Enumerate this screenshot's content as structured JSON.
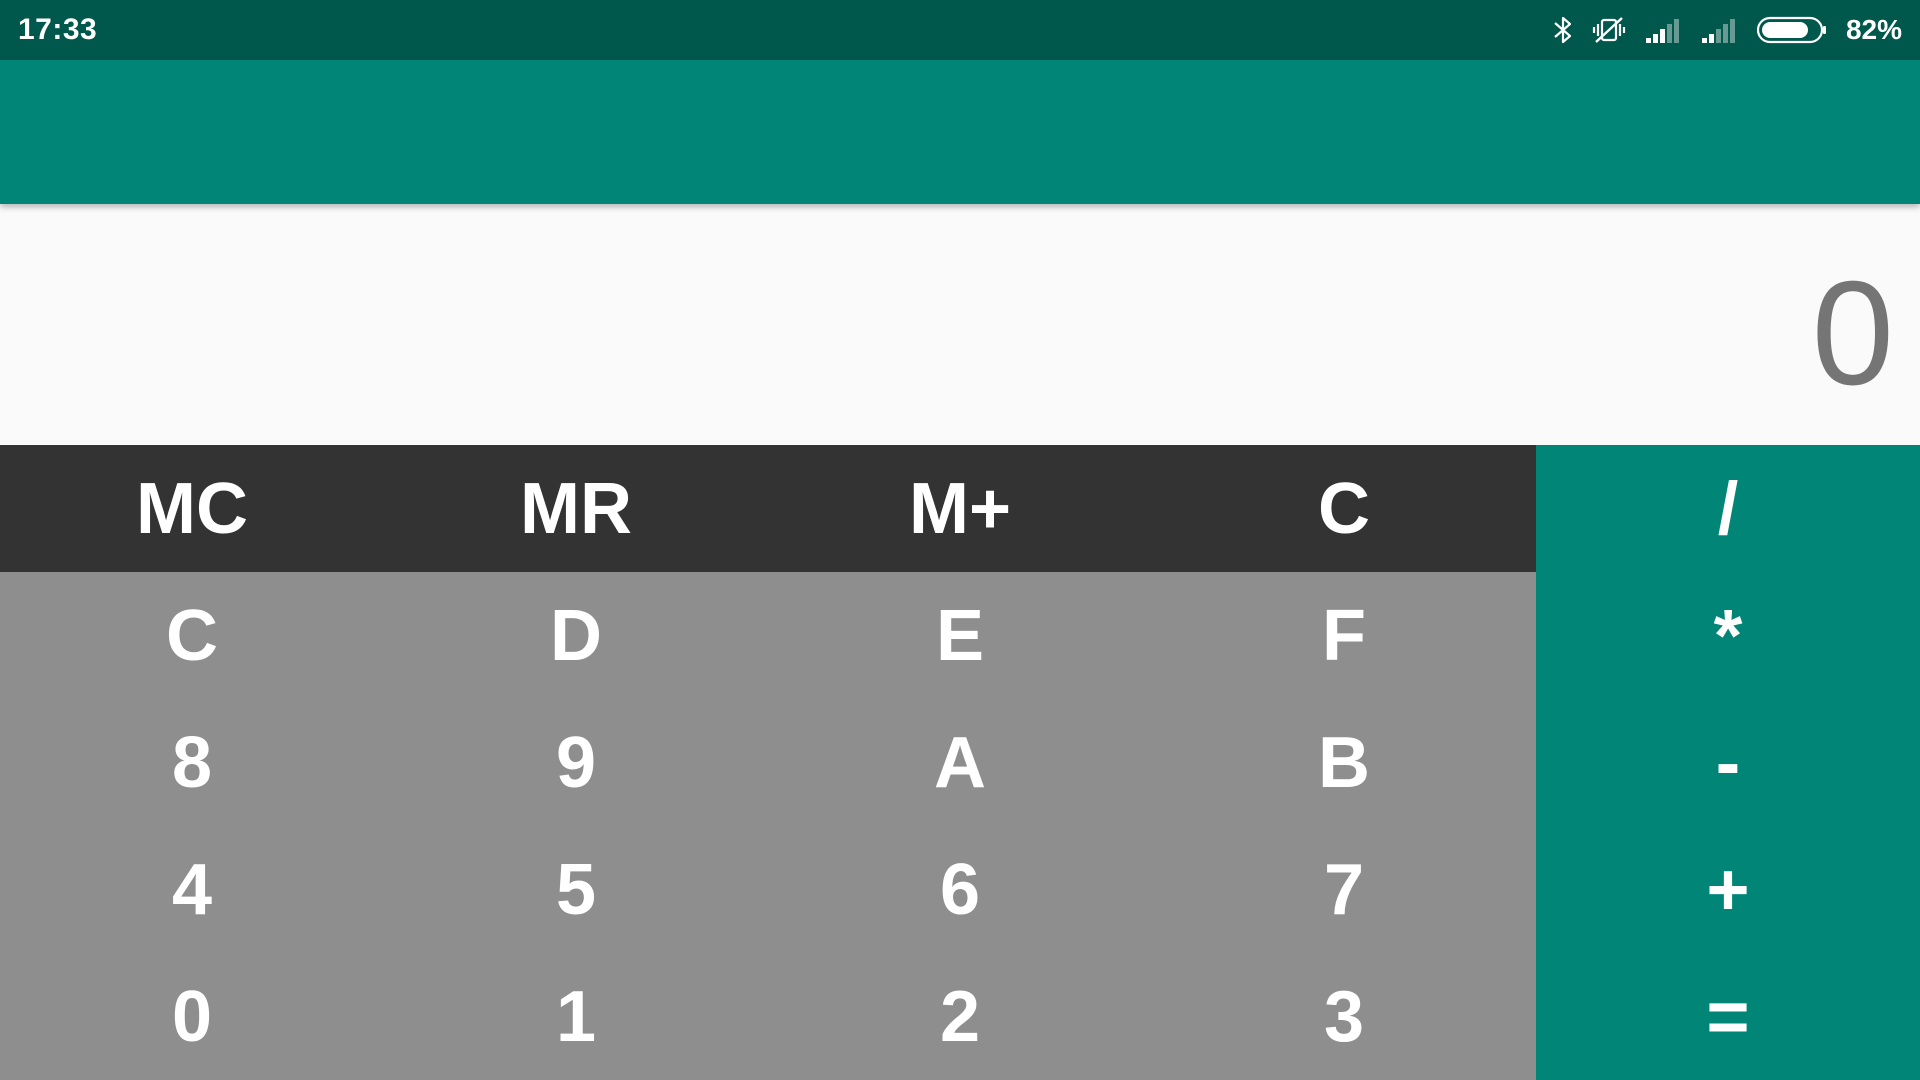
{
  "status_bar": {
    "time": "17:33",
    "battery_percent": "82%",
    "icons": [
      "bluetooth-icon",
      "vibrate-off-icon",
      "signal-icon",
      "signal-icon",
      "battery-icon"
    ],
    "battery_level": 0.82
  },
  "display": {
    "value": "0"
  },
  "keypad": {
    "memory_row": [
      "MC",
      "MR",
      "M+",
      "C"
    ],
    "rows": [
      [
        "C",
        "D",
        "E",
        "F"
      ],
      [
        "8",
        "9",
        "A",
        "B"
      ],
      [
        "4",
        "5",
        "6",
        "7"
      ],
      [
        "0",
        "1",
        "2",
        "3"
      ]
    ],
    "operators": [
      "/",
      "*",
      "-",
      "+",
      "="
    ]
  },
  "colors": {
    "status_bar": "#00574b",
    "app_bar": "#008577",
    "memory_row": "#333333",
    "number_keys": "#8e8e8e",
    "operator_column": "#008577",
    "display_text": "#757575"
  }
}
